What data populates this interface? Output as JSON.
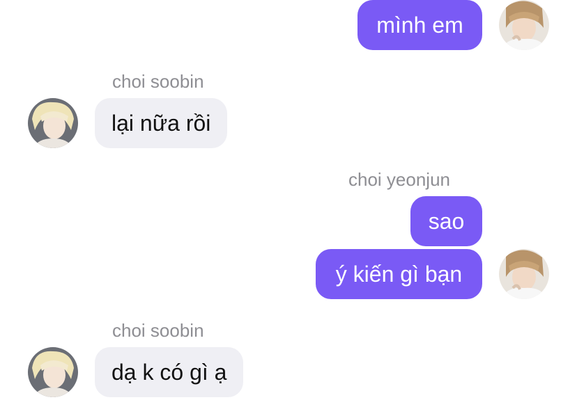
{
  "conversation": {
    "messages": [
      {
        "sender": "",
        "text": "mình em",
        "direction": "outgoing"
      },
      {
        "sender": "choi soobin",
        "text": "lại nữa rồi",
        "direction": "incoming"
      },
      {
        "sender": "choi yeonjun",
        "text": "sao",
        "direction": "outgoing"
      },
      {
        "sender": "",
        "text": "ý kiến gì bạn",
        "direction": "outgoing"
      },
      {
        "sender": "choi soobin",
        "text": "dạ k có gì ạ",
        "direction": "incoming"
      }
    ]
  },
  "colors": {
    "outgoing_bubble": "#7a5af5",
    "incoming_bubble": "#efeff4",
    "sender_name": "#8e8e93"
  },
  "icons": {
    "outgoing_avatar": "avatar-choi-yeonjun",
    "incoming_avatar": "avatar-choi-soobin"
  }
}
